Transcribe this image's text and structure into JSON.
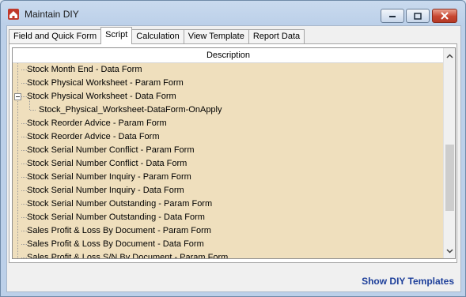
{
  "window": {
    "title": "Maintain DIY"
  },
  "tabs": [
    {
      "label": "Field and Quick Form",
      "active": false
    },
    {
      "label": "Script",
      "active": true
    },
    {
      "label": "Calculation",
      "active": false
    },
    {
      "label": "View Template",
      "active": false
    },
    {
      "label": "Report Data",
      "active": false
    }
  ],
  "grid": {
    "column_header": "Description",
    "rows": [
      {
        "label": "Stock Month End - Data Form",
        "level": 0
      },
      {
        "label": "Stock Physical Worksheet - Param Form",
        "level": 0
      },
      {
        "label": "Stock Physical Worksheet - Data Form",
        "level": 0,
        "expanded": true
      },
      {
        "label": "Stock_Physical_Worksheet-DataForm-OnApply",
        "level": 1
      },
      {
        "label": "Stock Reorder Advice - Param Form",
        "level": 0
      },
      {
        "label": "Stock Reorder Advice - Data Form",
        "level": 0
      },
      {
        "label": "Stock Serial Number Conflict - Param Form",
        "level": 0
      },
      {
        "label": "Stock Serial Number Conflict - Data Form",
        "level": 0
      },
      {
        "label": "Stock Serial Number Inquiry - Param Form",
        "level": 0
      },
      {
        "label": "Stock Serial Number Inquiry - Data Form",
        "level": 0
      },
      {
        "label": "Stock Serial Number Outstanding - Param Form",
        "level": 0
      },
      {
        "label": "Stock Serial Number Outstanding - Data Form",
        "level": 0
      },
      {
        "label": "Sales Profit & Loss By Document - Param Form",
        "level": 0
      },
      {
        "label": "Sales Profit & Loss By Document - Data Form",
        "level": 0
      },
      {
        "label": "Sales Profit & Loss S/N By Document - Param Form",
        "level": 0
      }
    ]
  },
  "footer": {
    "link_label": "Show DIY Templates"
  },
  "colors": {
    "row_background": "#efdfbd",
    "link": "#1d3f9a"
  }
}
